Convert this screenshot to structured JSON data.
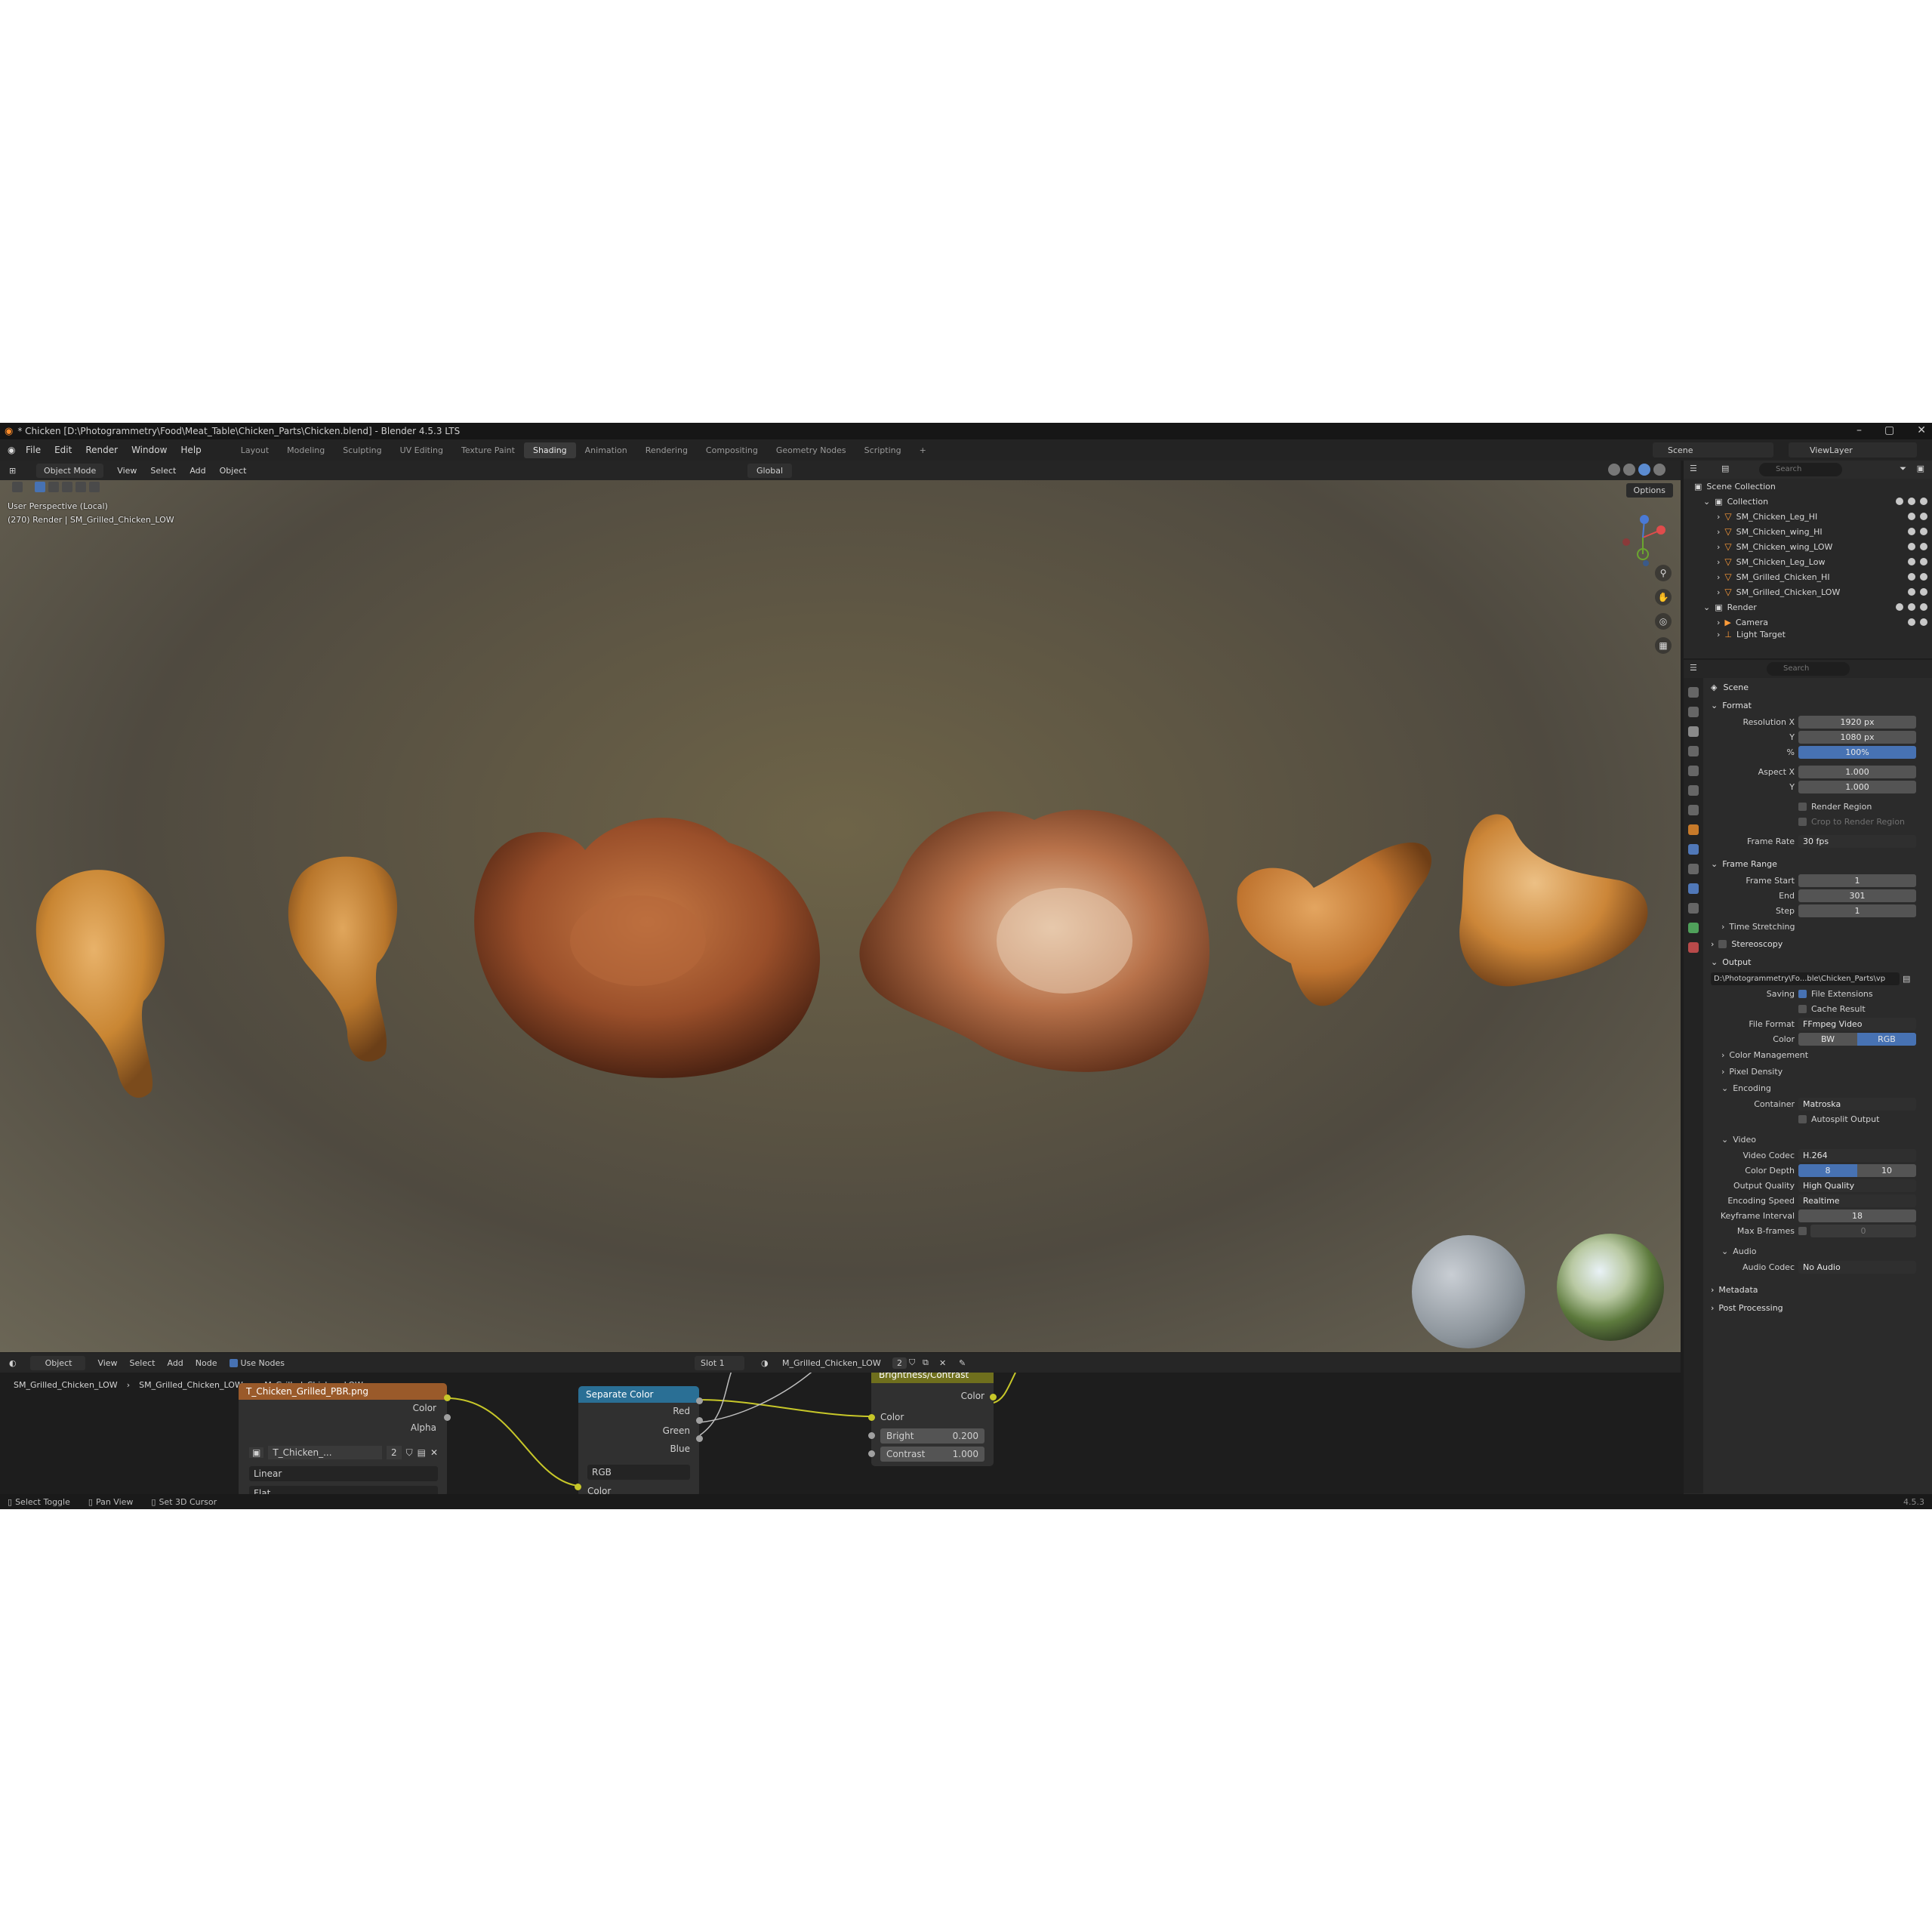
{
  "window": {
    "title": "* Chicken [D:\\Photogrammetry\\Food\\Meat_Table\\Chicken_Parts\\Chicken.blend] - Blender 4.5.3 LTS"
  },
  "menu": [
    "File",
    "Edit",
    "Render",
    "Window",
    "Help"
  ],
  "workspaces": [
    {
      "label": "Layout",
      "active": false
    },
    {
      "label": "Modeling",
      "active": false
    },
    {
      "label": "Sculpting",
      "active": false
    },
    {
      "label": "UV Editing",
      "active": false
    },
    {
      "label": "Texture Paint",
      "active": false
    },
    {
      "label": "Shading",
      "active": true
    },
    {
      "label": "Animation",
      "active": false
    },
    {
      "label": "Rendering",
      "active": false
    },
    {
      "label": "Compositing",
      "active": false
    },
    {
      "label": "Geometry Nodes",
      "active": false
    },
    {
      "label": "Scripting",
      "active": false
    }
  ],
  "scene_selector": "Scene",
  "view_layer": "ViewLayer",
  "viewport": {
    "mode": "Object Mode",
    "menus": [
      "View",
      "Select",
      "Add",
      "Object"
    ],
    "orientation": "Global",
    "options": "Options",
    "overlay_line1": "User Perspective (Local)",
    "overlay_line2": "(270) Render | SM_Grilled_Chicken_LOW"
  },
  "outliner": {
    "search_placeholder": "Search",
    "root": "Scene Collection",
    "collection": "Collection",
    "items": [
      "SM_Chicken_Leg_HI",
      "SM_Chicken_wing_HI",
      "SM_Chicken_wing_LOW",
      "SM_Chicken_Leg_Low",
      "SM_Grilled_Chicken_HI",
      "SM_Grilled_Chicken_LOW"
    ],
    "render_collection": "Render",
    "render_items": [
      "Camera",
      "Light Target"
    ]
  },
  "properties": {
    "search_placeholder": "Search",
    "context": "Scene",
    "format": {
      "title": "Format",
      "resolution_x_label": "Resolution X",
      "resolution_x": "1920 px",
      "y_label": "Y",
      "resolution_y": "1080 px",
      "pct_label": "%",
      "resolution_pct": "100%",
      "aspect_x_label": "Aspect X",
      "aspect_x": "1.000",
      "aspect_y": "1.000",
      "render_region": "Render Region",
      "crop_region": "Crop to Render Region",
      "frame_rate_label": "Frame Rate",
      "frame_rate": "30 fps"
    },
    "frame_range": {
      "title": "Frame Range",
      "start_label": "Frame Start",
      "start": "1",
      "end_label": "End",
      "end": "301",
      "step_label": "Step",
      "step": "1",
      "time_stretching": "Time Stretching"
    },
    "stereoscopy": "Stereoscopy",
    "output": {
      "title": "Output",
      "path": "D:\\Photogrammetry\\Fo...ble\\Chicken_Parts\\vp",
      "saving_label": "Saving",
      "file_extensions": "File Extensions",
      "cache_result": "Cache Result",
      "file_format_label": "File Format",
      "file_format": "FFmpeg Video",
      "color_label": "Color",
      "color_options": [
        "BW",
        "RGB"
      ],
      "color_management": "Color Management",
      "pixel_density": "Pixel Density"
    },
    "encoding": {
      "title": "Encoding",
      "container_label": "Container",
      "container": "Matroska",
      "autosplit": "Autosplit Output"
    },
    "video": {
      "title": "Video",
      "codec_label": "Video Codec",
      "codec": "H.264",
      "depth_label": "Color Depth",
      "depth_options": [
        "8",
        "10"
      ],
      "quality_label": "Output Quality",
      "quality": "High Quality",
      "speed_label": "Encoding Speed",
      "speed": "Realtime",
      "keyframe_label": "Keyframe Interval",
      "keyframe": "18",
      "bframes_label": "Max B-frames",
      "bframes": "0"
    },
    "audio": {
      "title": "Audio",
      "codec_label": "Audio Codec",
      "codec": "No Audio"
    },
    "metadata": "Metadata",
    "post_processing": "Post Processing"
  },
  "node_editor": {
    "object": "Object",
    "menus": [
      "View",
      "Select",
      "Add",
      "Node"
    ],
    "use_nodes": "Use Nodes",
    "slot": "Slot 1",
    "material": "M_Grilled_Chicken_LOW",
    "users": "2",
    "breadcrumb": [
      "SM_Grilled_Chicken_LOW",
      "SM_Grilled_Chicken_LOW",
      "M_Grilled_Chicken_LOW"
    ],
    "image_node": {
      "title": "T_Chicken_Grilled_PBR.png",
      "out_color": "Color",
      "out_alpha": "Alpha",
      "image_name": "T_Chicken_...",
      "image_users": "2",
      "interpolation": "Linear",
      "projection": "Flat"
    },
    "separate_node": {
      "title": "Separate Color",
      "red": "Red",
      "green": "Green",
      "blue": "Blue",
      "mode": "RGB",
      "in_color": "Color"
    },
    "bc_node": {
      "title": "Brightness/Contrast",
      "out_color": "Color",
      "in_color": "Color",
      "bright_label": "Bright",
      "bright": "0.200",
      "contrast_label": "Contrast",
      "contrast": "1.000"
    }
  },
  "statusbar": {
    "items": [
      "Select Toggle",
      "Pan View",
      "Set 3D Cursor"
    ],
    "version": "4.5.3"
  },
  "colors": {
    "accent_blue": "#4772b3",
    "object_orange": "#ff9c3a",
    "image_node_header": "#9a5a2a",
    "separate_node_header": "#2a6f95",
    "bc_node_header": "#6f6f1d"
  }
}
